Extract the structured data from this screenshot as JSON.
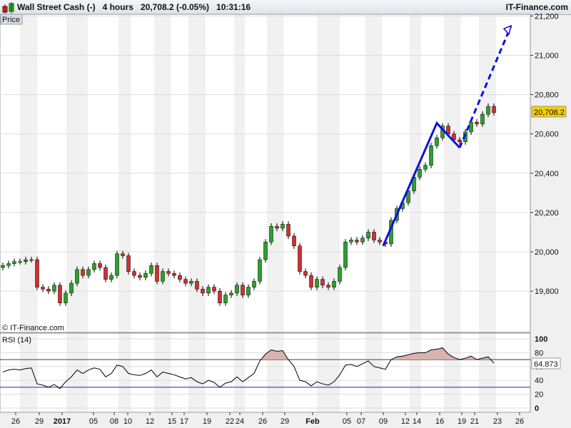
{
  "header": {
    "instrument": "Wall Street Cash (-)",
    "timeframe": "4 hours",
    "quote": "20,708.2 (-0.05%)",
    "time": "10:31:16",
    "brand": "IT-Finance.com"
  },
  "price_panel": {
    "label": "Price",
    "copyright": "© IT-Finance.com",
    "last_price_label": "20,708.2"
  },
  "rsi_panel": {
    "label": "RSI (14)",
    "last_value_label": "64.873"
  },
  "colors": {
    "up": "#2ca02c",
    "down": "#d03030",
    "trendline": "#1010e0",
    "rsi_fill": "#d8b4ae",
    "last_price_bg": "#f5d000"
  },
  "chart_data": {
    "type": "candlestick",
    "title": "Wall Street Cash (-) 4 hours",
    "price_axis": {
      "ticks": [
        19800,
        20000,
        20200,
        20400,
        20600,
        20800,
        21000,
        21200
      ],
      "tick_labels": [
        "19,800",
        "20,000",
        "20,200",
        "20,400",
        "20,600",
        "20,800",
        "21,000",
        "21,200"
      ],
      "range": [
        19640,
        21230
      ]
    },
    "x_tick_labels": [
      "26",
      "29",
      "2017",
      "05",
      "08",
      "10",
      "12",
      "15",
      "17",
      "19",
      "22",
      "24",
      "26",
      "29",
      "Feb",
      "05",
      "07",
      "09",
      "12",
      "14",
      "16",
      "19",
      "21",
      "23",
      "26"
    ],
    "closes": [
      19930,
      19940,
      19950,
      19950,
      19960,
      19960,
      19820,
      19810,
      19800,
      19830,
      19740,
      19790,
      19840,
      19910,
      19880,
      19910,
      19940,
      19920,
      19860,
      19880,
      19990,
      19980,
      19900,
      19880,
      19870,
      19890,
      19930,
      19850,
      19900,
      19890,
      19880,
      19860,
      19840,
      19850,
      19810,
      19790,
      19820,
      19800,
      19740,
      19780,
      19790,
      19830,
      19780,
      19820,
      19850,
      19960,
      20050,
      20130,
      20120,
      20140,
      20080,
      20030,
      19900,
      19880,
      19820,
      19860,
      19830,
      19820,
      19850,
      19920,
      20050,
      20060,
      20050,
      20070,
      20100,
      20060,
      20050,
      20040,
      20160,
      20220,
      20250,
      20310,
      20380,
      20420,
      20440,
      20540,
      20580,
      20640,
      20600,
      20570,
      20560,
      20610,
      20660,
      20650,
      20700,
      20740,
      20708.2
    ],
    "trendlines": [
      {
        "style": "solid",
        "points": [
          [
            66.6,
            20030
          ],
          [
            76,
            20655
          ],
          [
            80,
            20530
          ]
        ]
      },
      {
        "style": "dashed",
        "arrow": true,
        "points": [
          [
            80,
            20530
          ],
          [
            89,
            21150
          ]
        ]
      }
    ],
    "rsi": {
      "period": 14,
      "levels": [
        30,
        70
      ],
      "ticks": [
        0,
        20,
        40,
        60,
        80,
        100
      ],
      "values": [
        52,
        55,
        56,
        55,
        57,
        58,
        35,
        33,
        30,
        34,
        28,
        38,
        45,
        55,
        50,
        55,
        58,
        56,
        45,
        50,
        62,
        60,
        50,
        48,
        47,
        50,
        55,
        45,
        52,
        50,
        48,
        45,
        42,
        44,
        38,
        35,
        40,
        37,
        30,
        36,
        38,
        45,
        38,
        44,
        50,
        68,
        78,
        84,
        82,
        83,
        70,
        60,
        40,
        38,
        32,
        38,
        35,
        33,
        38,
        48,
        62,
        63,
        60,
        64,
        68,
        60,
        58,
        56,
        70,
        74,
        75,
        77,
        79,
        80,
        80,
        84,
        85,
        87,
        78,
        73,
        70,
        72,
        75,
        70,
        72,
        74,
        64.873
      ]
    }
  }
}
